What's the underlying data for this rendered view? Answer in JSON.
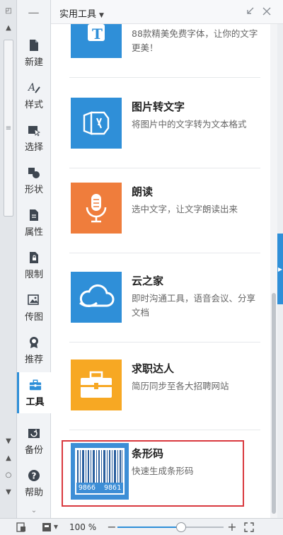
{
  "panel": {
    "title": "实用工具"
  },
  "nav": {
    "items": [
      {
        "label": "新建",
        "icon": "new-doc-icon"
      },
      {
        "label": "样式",
        "icon": "style-icon"
      },
      {
        "label": "选择",
        "icon": "select-icon"
      },
      {
        "label": "形状",
        "icon": "shape-icon"
      },
      {
        "label": "属性",
        "icon": "properties-icon"
      },
      {
        "label": "限制",
        "icon": "restrict-icon"
      },
      {
        "label": "传图",
        "icon": "upload-image-icon"
      },
      {
        "label": "推荐",
        "icon": "recommend-icon"
      },
      {
        "label": "工具",
        "icon": "toolbox-icon",
        "active": true
      },
      {
        "label": "备份",
        "icon": "backup-icon"
      },
      {
        "label": "帮助",
        "icon": "help-icon"
      }
    ]
  },
  "tools": [
    {
      "title": "",
      "desc": "88款精美免费字体，让你的文字更美！",
      "color": "#2f8fd8",
      "icon": "font-icon"
    },
    {
      "title": "图片转文字",
      "desc": "将图片中的文字转为文本格式",
      "color": "#2f8fd8",
      "icon": "image-to-text-icon"
    },
    {
      "title": "朗读",
      "desc": "选中文字，让文字朗读出来",
      "color": "#ef7d3c",
      "icon": "microphone-icon"
    },
    {
      "title": "云之家",
      "desc": "即时沟通工具，语音会议、分享文档",
      "color": "#2f8fd8",
      "icon": "cloud-icon"
    },
    {
      "title": "求职达人",
      "desc": "简历同步至各大招聘网站",
      "color": "#f7a823",
      "icon": "briefcase-icon"
    },
    {
      "title": "条形码",
      "desc": "快速生成条形码",
      "color": "#3d8ed6",
      "icon": "barcode-icon",
      "barcode_text": "9866  9861"
    }
  ],
  "status": {
    "zoom_label": "100 %",
    "zoom_level": 0.6,
    "minus": "−",
    "plus": "+"
  },
  "colors": {
    "accent": "#2f8fd8",
    "highlight": "#d9393f"
  }
}
